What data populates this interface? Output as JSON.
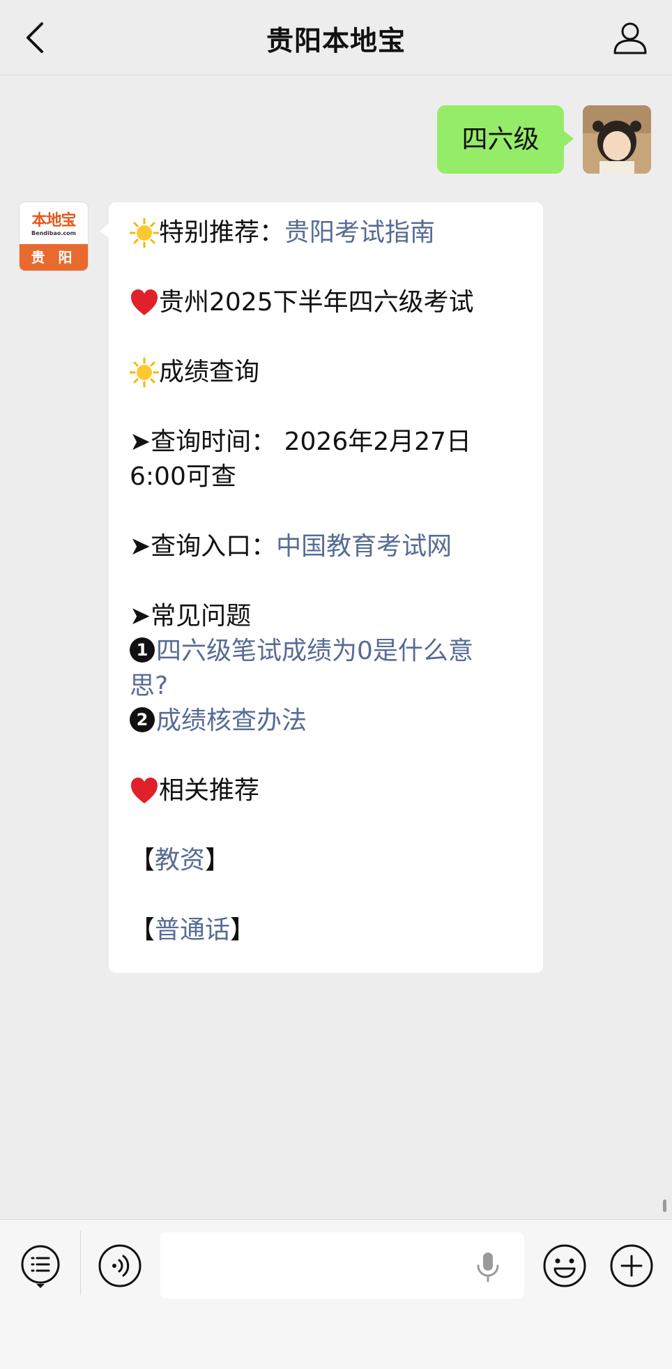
{
  "header": {
    "title": "贵阳本地宝",
    "back_icon": "chevron-left-icon",
    "profile_icon": "person-icon"
  },
  "outgoing_message": {
    "text": "四六级",
    "bubble_color": "#95ec69"
  },
  "sender": {
    "logo_name": "本地宝",
    "logo_url": "Bendibao.com",
    "logo_city": "贵 阳",
    "accent_color": "#e96a2e"
  },
  "incoming_message": {
    "link_color": "#576b95",
    "line1_prefix": "特别推荐：",
    "line1_link": "贵阳考试指南",
    "line2": "贵州2025下半年四六级考试",
    "line3": "成绩查询",
    "line4a": "➤查询时间： 2026年2月27日",
    "line4b": "6:00可查",
    "line5_prefix": "➤查询入口：",
    "line5_link": "中国教育考试网",
    "line6": "➤常见问题",
    "faq1_num": "1",
    "faq1_link_a": "四六级笔试成绩为0是什么意",
    "faq1_link_b": "思?",
    "faq2_num": "2",
    "faq2_link": "成绩核查办法",
    "line7": "相关推荐",
    "rec1_open": "【",
    "rec1_link": "教资",
    "rec1_close": "】",
    "rec2_open": "【",
    "rec2_link": "普通话",
    "rec2_close": "】"
  },
  "input_bar": {
    "menu_icon": "list-menu-icon",
    "voice_icon": "voice-icon",
    "input_value": "",
    "mic_icon": "microphone-icon",
    "emoji_icon": "emoji-icon",
    "plus_icon": "plus-icon"
  }
}
